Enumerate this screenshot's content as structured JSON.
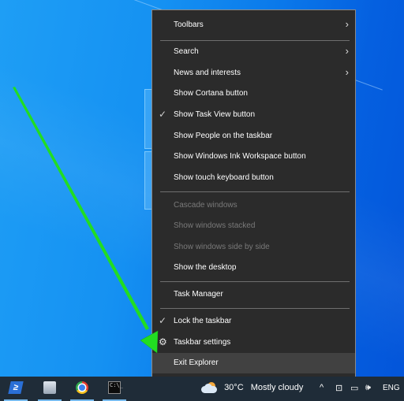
{
  "context_menu": {
    "items": [
      {
        "label": "Toolbars",
        "submenu": true,
        "checked": false,
        "enabled": true
      },
      {
        "label": "Search",
        "submenu": true,
        "checked": false,
        "enabled": true
      },
      {
        "label": "News and interests",
        "submenu": true,
        "checked": false,
        "enabled": true
      },
      {
        "label": "Show Cortana button",
        "submenu": false,
        "checked": false,
        "enabled": true
      },
      {
        "label": "Show Task View button",
        "submenu": false,
        "checked": true,
        "enabled": true
      },
      {
        "label": "Show People on the taskbar",
        "submenu": false,
        "checked": false,
        "enabled": true
      },
      {
        "label": "Show Windows Ink Workspace button",
        "submenu": false,
        "checked": false,
        "enabled": true
      },
      {
        "label": "Show touch keyboard button",
        "submenu": false,
        "checked": false,
        "enabled": true
      },
      {
        "label": "Cascade windows",
        "submenu": false,
        "checked": false,
        "enabled": false
      },
      {
        "label": "Show windows stacked",
        "submenu": false,
        "checked": false,
        "enabled": false
      },
      {
        "label": "Show windows side by side",
        "submenu": false,
        "checked": false,
        "enabled": false
      },
      {
        "label": "Show the desktop",
        "submenu": false,
        "checked": false,
        "enabled": true
      },
      {
        "label": "Task Manager",
        "submenu": false,
        "checked": false,
        "enabled": true
      },
      {
        "label": "Lock the taskbar",
        "submenu": false,
        "checked": true,
        "enabled": true
      },
      {
        "label": "Taskbar settings",
        "submenu": false,
        "checked": false,
        "enabled": true,
        "icon": "gear-icon"
      },
      {
        "label": "Exit Explorer",
        "submenu": false,
        "checked": false,
        "enabled": true,
        "highlighted": true
      }
    ],
    "glyphs": {
      "chevron": "›",
      "check": "✓",
      "gear": "⚙"
    }
  },
  "annotation": {
    "arrow_color": "#22dd22",
    "points_to": "Exit Explorer"
  },
  "taskbar": {
    "apps": [
      {
        "name": "powershell",
        "glyph": "≥"
      },
      {
        "name": "resource-monitor",
        "glyph": ""
      },
      {
        "name": "chrome",
        "glyph": ""
      },
      {
        "name": "command-prompt",
        "glyph": "C:\\_"
      }
    ],
    "weather": {
      "temperature": "30°C",
      "condition": "Mostly cloudy"
    },
    "tray": {
      "overflow": "^",
      "meet": "⊡",
      "network": "▭",
      "volume": "🕪",
      "language": "ENG"
    }
  },
  "colors": {
    "menu_bg": "#2b2b2b",
    "taskbar_bg": "#1f2c38",
    "desktop": "#1591f2",
    "highlight": "#414141"
  }
}
